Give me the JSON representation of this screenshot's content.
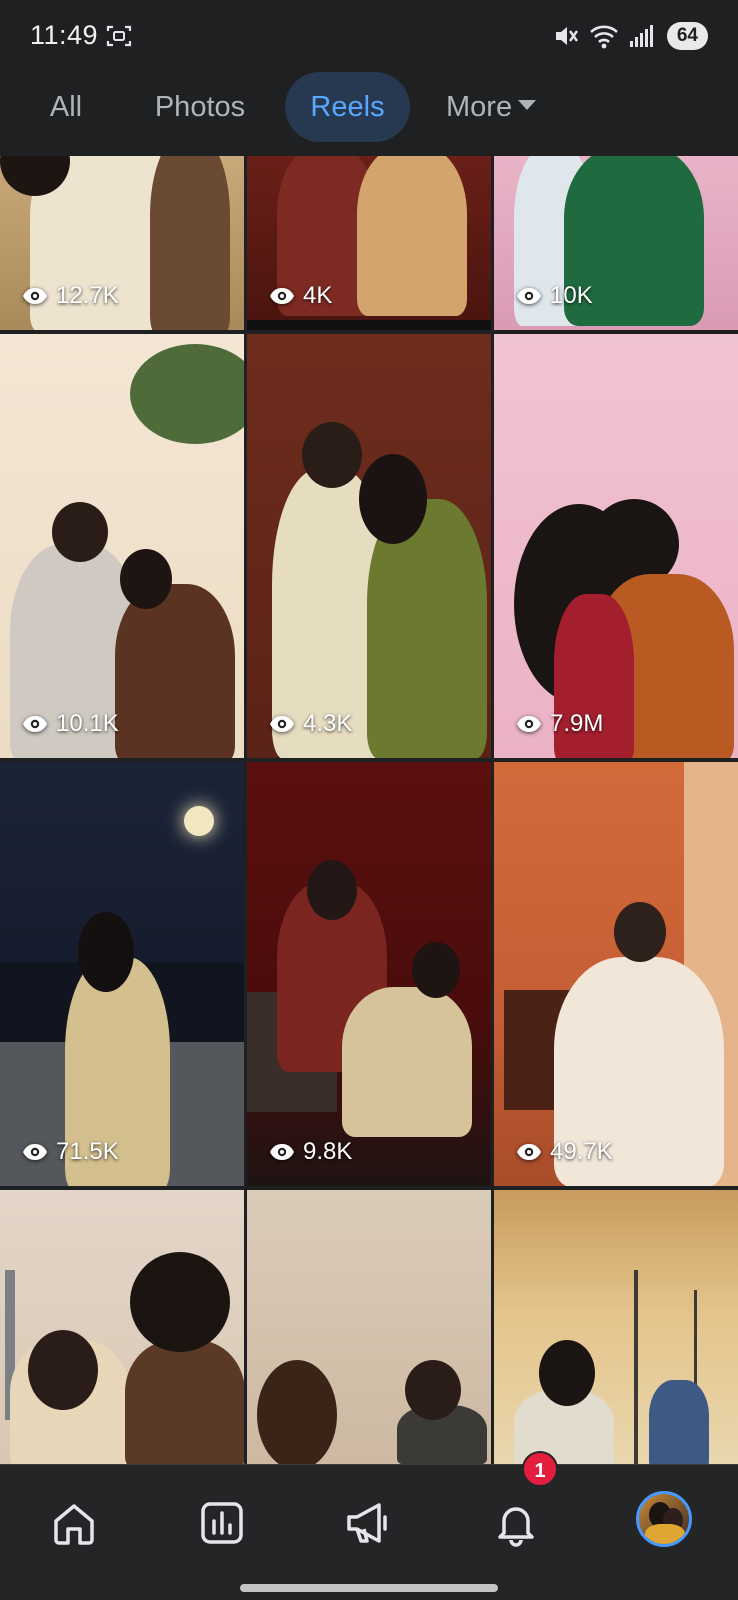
{
  "status_bar": {
    "time": "11:49",
    "battery": "64",
    "icons": [
      "screenshot-icon",
      "mute-vibrate-icon",
      "wifi-icon",
      "signal-icon"
    ]
  },
  "tabs": [
    {
      "label": "All",
      "active": false
    },
    {
      "label": "Photos",
      "active": false
    },
    {
      "label": "Reels",
      "active": true
    },
    {
      "label": "More",
      "active": false
    }
  ],
  "reels": [
    {
      "views": "12.7K"
    },
    {
      "views": "4K"
    },
    {
      "views": "10K"
    },
    {
      "views": "10.1K"
    },
    {
      "views": "4.3K"
    },
    {
      "views": "7.9M"
    },
    {
      "views": "71.5K"
    },
    {
      "views": "9.8K"
    },
    {
      "views": "49.7K"
    },
    {
      "views": ""
    },
    {
      "views": ""
    },
    {
      "views": ""
    }
  ],
  "bottom_nav": {
    "items": [
      "home-icon",
      "dashboard-icon",
      "megaphone-icon",
      "notifications-icon",
      "profile-avatar"
    ],
    "notification_count": "1"
  },
  "colors": {
    "background": "#1f2022",
    "active_tab_bg": "#263951",
    "active_tab_text": "#5aa7ff",
    "badge": "#e41e3f"
  }
}
